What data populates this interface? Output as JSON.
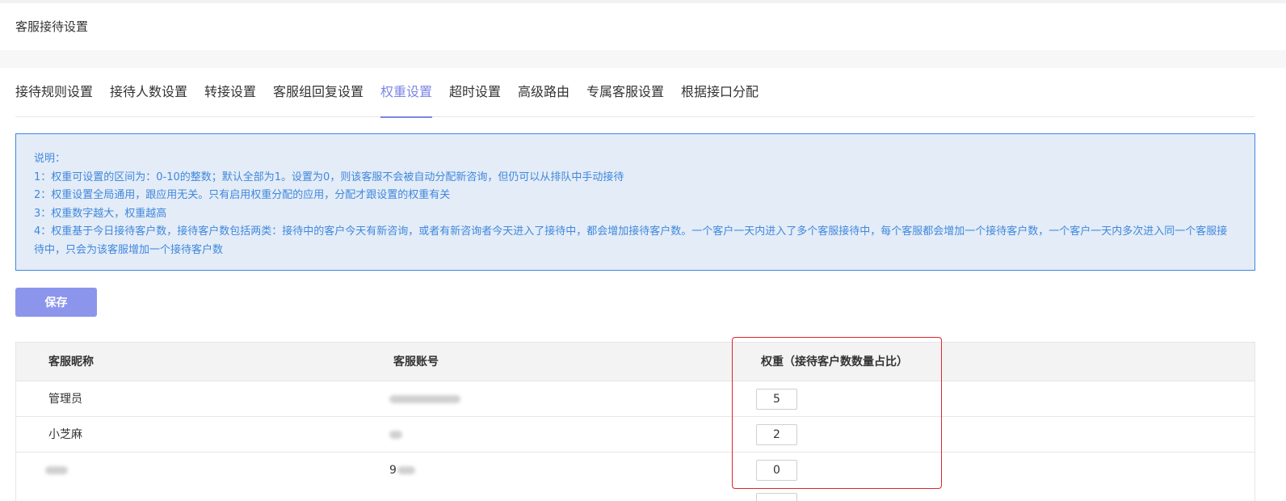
{
  "header": {
    "title": "客服接待设置"
  },
  "tabs": [
    {
      "label": "接待规则设置",
      "active": false
    },
    {
      "label": "接待人数设置",
      "active": false
    },
    {
      "label": "转接设置",
      "active": false
    },
    {
      "label": "客服组回复设置",
      "active": false
    },
    {
      "label": "权重设置",
      "active": true
    },
    {
      "label": "超时设置",
      "active": false
    },
    {
      "label": "高级路由",
      "active": false
    },
    {
      "label": "专属客服设置",
      "active": false
    },
    {
      "label": "根据接口分配",
      "active": false
    }
  ],
  "notice": {
    "title": "说明：",
    "lines": [
      "1：权重可设置的区间为：0-10的整数；默认全部为1。设置为0，则该客服不会被自动分配新咨询，但仍可以从排队中手动接待",
      "2：权重设置全局通用，跟应用无关。只有启用权重分配的应用，分配才跟设置的权重有关",
      "3：权重数字越大，权重越高",
      "4：权重基于今日接待客户数，接待客户数包括两类：接待中的客户今天有新咨询，或者有新咨询者今天进入了接待中，都会增加接待客户数。一个客户一天内进入了多个客服接待中，每个客服都会增加一个接待客户数，一个客户一天内多次进入同一个客服接待中，只会为该客服增加一个接待客户数"
    ]
  },
  "actions": {
    "save_label": "保存"
  },
  "table": {
    "columns": [
      "客服昵称",
      "客服账号",
      "权重（接待客户数数量占比）"
    ],
    "rows": [
      {
        "nickname": "管理员",
        "account": "",
        "weight": "5"
      },
      {
        "nickname": "小芝麻",
        "account": "",
        "weight": "2"
      },
      {
        "nickname": "",
        "account": "9",
        "weight": "0"
      }
    ]
  },
  "colors": {
    "accent": "#7b86e6",
    "button": "#8c95ec",
    "notice_text": "#3f88dd",
    "notice_bg": "#e4ecf7",
    "highlight": "#e0242a"
  }
}
